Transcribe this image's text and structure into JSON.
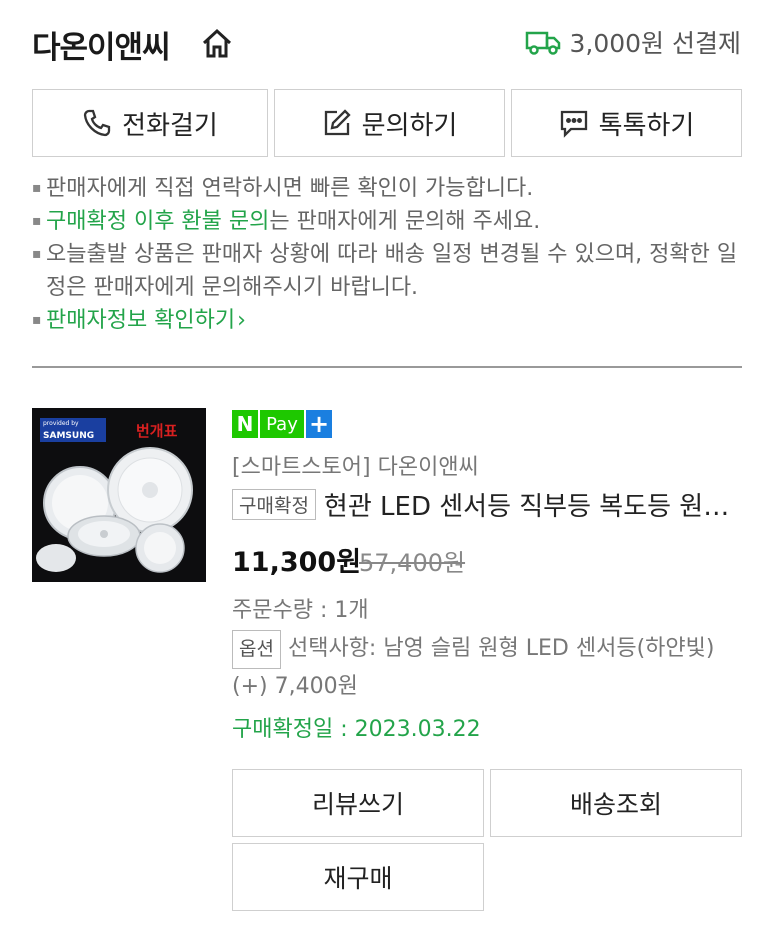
{
  "seller": {
    "name": "다온이앤씨",
    "home_icon": "home-icon"
  },
  "shipping": {
    "icon": "truck-icon",
    "text": "3,000원 선결제",
    "icon_color": "#23a44a"
  },
  "contact_buttons": [
    {
      "label": "전화걸기",
      "icon": "phone-icon"
    },
    {
      "label": "문의하기",
      "icon": "edit-icon"
    },
    {
      "label": "톡톡하기",
      "icon": "chat-icon"
    }
  ],
  "notes": {
    "line1": "판매자에게 직접 연락하시면 빠른 확인이 가능합니다.",
    "line2_green": "구매확정 이후 환불 문의",
    "line2_rest": "는 판매자에게 문의해 주세요.",
    "line3": "오늘출발 상품은 판매자 상황에 따라 배송 일정 변경될 수 있으며, 정확한 일정은 판매자에게 문의해주시기 바랍니다.",
    "line4_link": "판매자정보 확인하기"
  },
  "product": {
    "thumb": {
      "badge_top": "provided by",
      "badge": "SAMSUNG",
      "brand": "번개표"
    },
    "npay": {
      "n": "N",
      "pay": "Pay",
      "plus": "+"
    },
    "store": "[스마트스토어] 다온이앤씨",
    "status_tag": "구매확정",
    "title": "현관 LED 센서등 직부등 복도등 원형 삼성 LED 칩",
    "price": "11,300원",
    "original_price": "57,400원",
    "quantity": "주문수량 : 1개",
    "option_tag": "옵션",
    "option_text": "선택사항: 남영 슬림 원형 LED 센서등(하얀빛) (+) 7,400원",
    "confirm_date": "구매확정일 : 2023.03.22"
  },
  "actions": {
    "review": "리뷰쓰기",
    "tracking": "배송조회",
    "rebuy": "재구매"
  },
  "colors": {
    "accent_green": "#23a44a",
    "npay_green": "#1ec800",
    "npay_blue": "#1a7fe0"
  }
}
